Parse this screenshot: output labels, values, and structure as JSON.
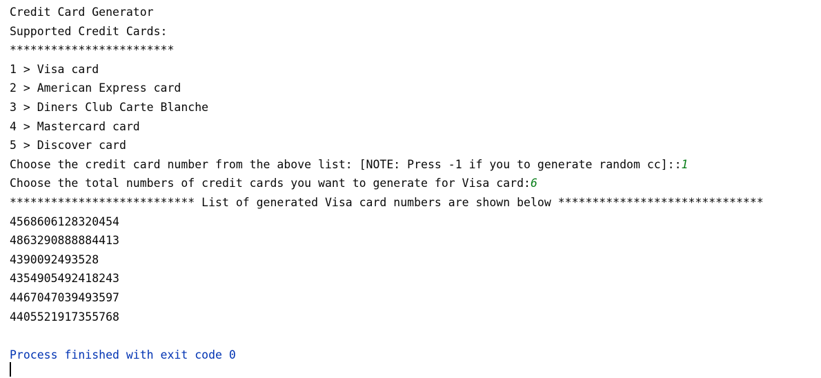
{
  "console": {
    "title": "Credit Card Generator",
    "supported_heading": "Supported Credit Cards:",
    "separator": "************************",
    "options": [
      "1 > Visa card",
      "2 > American Express card",
      "3 > Diners Club Carte Blanche",
      "4 > Mastercard card",
      "5 > Discover card"
    ],
    "prompt_card_type": "Choose the credit card number from the above list: [NOTE: Press -1 if you to generate random cc]::",
    "input_card_type": "1",
    "prompt_count": "Choose the total numbers of credit cards you want to generate for Visa card:",
    "input_count": "6",
    "list_header": "*************************** List of generated Visa card numbers are shown below ******************************",
    "card_numbers": [
      "4568606128320454",
      "4863290888884413",
      "4390092493528",
      "4354905492418243",
      "4467047039493597",
      "4405521917355768"
    ],
    "process_message": "Process finished with exit code 0"
  },
  "colors": {
    "input_value": "#067d17",
    "process_message": "#0033b3",
    "text": "#080808",
    "background": "#ffffff"
  }
}
